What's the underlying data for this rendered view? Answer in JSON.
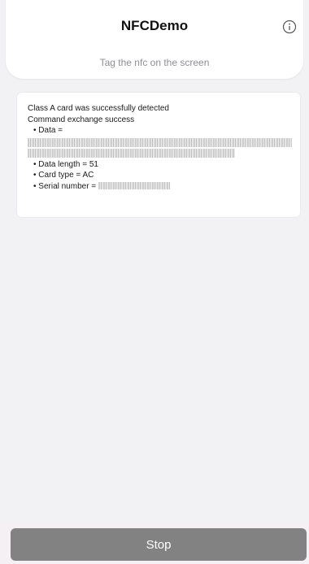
{
  "header": {
    "title": "NFCDemo",
    "subtitle": "Tag the nfc on the screen",
    "info_icon": "info-circle-icon"
  },
  "result": {
    "line1": "Class A card was successfully detected",
    "line2": "Command exchange success",
    "data_label": "• Data =",
    "data_length": "• Data length = 51",
    "card_type": "• Card type = AC",
    "serial_label": "• Serial number ="
  },
  "footer": {
    "stop_label": "Stop"
  },
  "colors": {
    "background": "#f2f2f4",
    "card": "#ffffff",
    "button": "#828282",
    "subtitle": "#8e8e93"
  }
}
